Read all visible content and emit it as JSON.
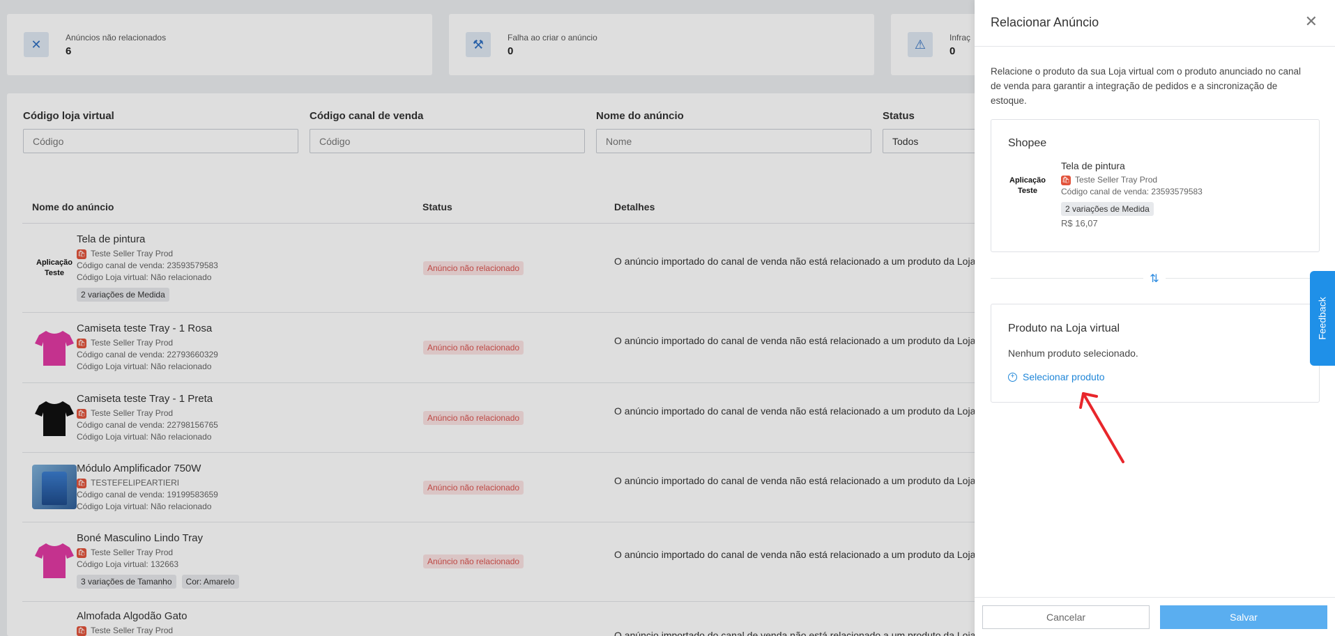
{
  "stats": [
    {
      "icon": "✕",
      "label": "Anúncios não relacionados",
      "value": "6"
    },
    {
      "icon": "⚒",
      "label": "Falha ao criar o anúncio",
      "value": "0"
    },
    {
      "icon": "⚠",
      "label": "Infraç",
      "value": "0"
    }
  ],
  "filters": [
    {
      "label": "Código loja virtual",
      "placeholder": "Código"
    },
    {
      "label": "Código canal de venda",
      "placeholder": "Código"
    },
    {
      "label": "Nome do anúncio",
      "placeholder": "Nome"
    },
    {
      "label": "Status",
      "value": "Todos"
    }
  ],
  "table": {
    "headers": {
      "name": "Nome do anúncio",
      "status": "Status",
      "details": "Detalhes"
    },
    "rows": [
      {
        "thumb_text": "Aplicação Teste",
        "name": "Tela de pintura",
        "seller": "Teste Seller Tray Prod",
        "channel_code": "Código canal de venda: 23593579583",
        "store_code": "Código Loja virtual: Não relacionado",
        "chips": [
          "2 variações de Medida"
        ],
        "status": "Anúncio não relacionado",
        "details": "O anúncio importado do canal de venda não está relacionado a um produto da Loja v"
      },
      {
        "thumb_text": "",
        "name": "Camiseta teste Tray - 1 Rosa",
        "seller": "Teste Seller Tray Prod",
        "channel_code": "Código canal de venda: 22793660329",
        "store_code": "Código Loja virtual: Não relacionado",
        "chips": [],
        "status": "Anúncio não relacionado",
        "details": "O anúncio importado do canal de venda não está relacionado a um produto da Loja v"
      },
      {
        "thumb_text": "",
        "name": "Camiseta teste Tray - 1 Preta",
        "seller": "Teste Seller Tray Prod",
        "channel_code": "Código canal de venda: 22798156765",
        "store_code": "Código Loja virtual: Não relacionado",
        "chips": [],
        "status": "Anúncio não relacionado",
        "details": "O anúncio importado do canal de venda não está relacionado a um produto da Loja v"
      },
      {
        "thumb_text": "",
        "name": "Módulo Amplificador 750W",
        "seller": "TESTEFELIPEARTIERI",
        "channel_code": "Código canal de venda: 19199583659",
        "store_code": "Código Loja virtual: Não relacionado",
        "chips": [],
        "status": "Anúncio não relacionado",
        "details": "O anúncio importado do canal de venda não está relacionado a um produto da Loja v"
      },
      {
        "thumb_text": "",
        "name": "Boné Masculino Lindo Tray",
        "seller": "Teste Seller Tray Prod",
        "channel_code": "Código Loja virtual: 132663",
        "store_code": "",
        "chips": [
          "3 variações de Tamanho",
          "Cor: Amarelo"
        ],
        "status": "Anúncio não relacionado",
        "details": "O anúncio importado do canal de venda não está relacionado a um produto da Loja v"
      },
      {
        "thumb_text": "",
        "name": "Almofada Algodão Gato",
        "seller": "Teste Seller Tray Prod",
        "channel_code": "",
        "store_code": "",
        "chips": [],
        "status": "Anúncio não relacionado",
        "details": "O anúncio importado do canal de venda não está relacionado a um produto da Loja v"
      }
    ]
  },
  "panel": {
    "title": "Relacionar Anúncio",
    "description": "Relacione o produto da sua Loja virtual com o produto anunciado no canal de venda para garantir a integração de pedidos e a sincronização de estoque.",
    "channel_card": {
      "title": "Shopee",
      "thumb_text": "Aplicação Teste",
      "name": "Tela de pintura",
      "seller": "Teste Seller Tray Prod",
      "channel_code": "Código canal de venda: 23593579583",
      "chip": "2 variações de Medida",
      "price": "R$ 16,07"
    },
    "store_card": {
      "title": "Produto na Loja virtual",
      "empty_text": "Nenhum produto selecionado.",
      "select_link": "Selecionar produto"
    },
    "cancel_label": "Cancelar",
    "save_label": "Salvar"
  },
  "feedback_label": "Feedback",
  "colors": {
    "accent": "#1f86d8",
    "save": "#5aaef0",
    "error": "#d9534f",
    "annotation": "#e8262b"
  }
}
